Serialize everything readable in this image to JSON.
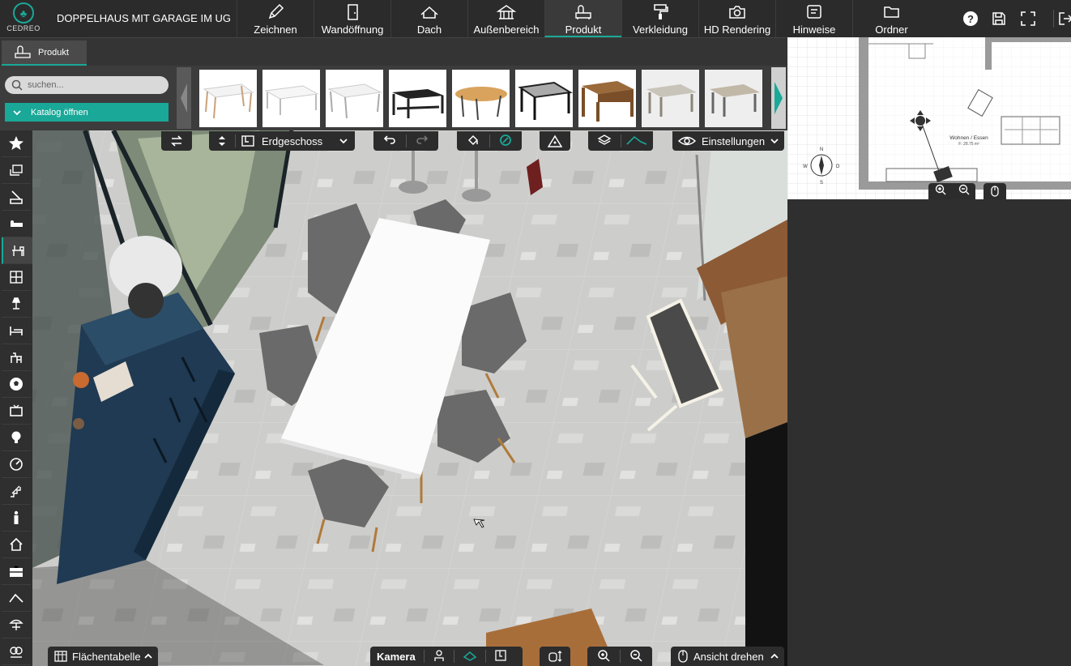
{
  "app": {
    "logo_text": "CEDREO",
    "project_title": "DOPPELHAUS MIT GARAGE IM UG"
  },
  "tabs": [
    {
      "label": "Zeichnen",
      "icon": "pencil-icon"
    },
    {
      "label": "Wandöffnung",
      "icon": "door-icon"
    },
    {
      "label": "Dach",
      "icon": "roof-icon"
    },
    {
      "label": "Außenbereich",
      "icon": "gazebo-icon"
    },
    {
      "label": "Produkt",
      "icon": "product-icon",
      "active": true
    },
    {
      "label": "Verkleidung",
      "icon": "paint-roller-icon"
    },
    {
      "label": "HD Rendering",
      "icon": "camera-icon"
    },
    {
      "label": "Hinweise",
      "icon": "notes-icon"
    },
    {
      "label": "Ordner",
      "icon": "folder-icon"
    }
  ],
  "subtab": {
    "label": "Produkt"
  },
  "catalog": {
    "search_placeholder": "suchen...",
    "open_label": "Katalog öffnen",
    "thumb_count": 9
  },
  "view_toolbar": {
    "floor_label": "Erdgeschoss",
    "settings_label": "Einstellungen"
  },
  "bottom": {
    "area_table_label": "Flächentabelle",
    "camera_label": "Kamera",
    "rotate_view_label": "Ansicht drehen"
  },
  "minimap": {
    "room_label": "Wohnen / Essen",
    "room_area": "F: 28.75 m²",
    "compass": {
      "n": "N",
      "s": "S",
      "w": "W",
      "o": "O"
    }
  },
  "colors": {
    "accent": "#1aa898"
  }
}
